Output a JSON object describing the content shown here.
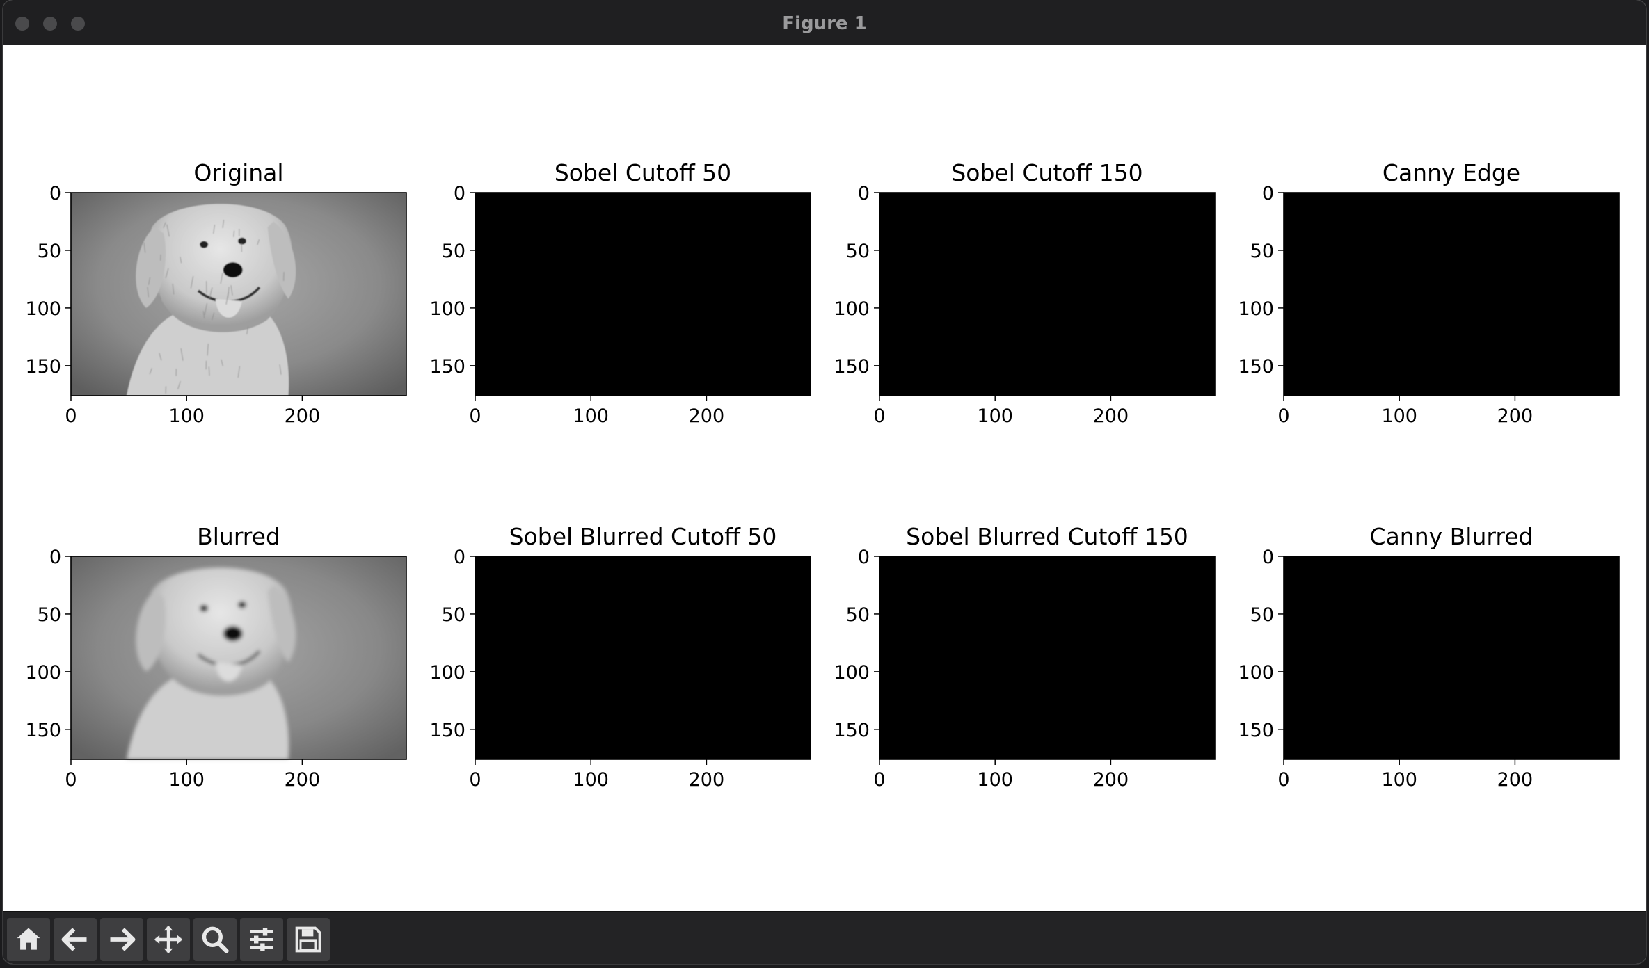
{
  "window": {
    "title": "Figure 1"
  },
  "figure": {
    "panels": [
      {
        "id": "original",
        "title": "Original",
        "kind": "photo",
        "sharp": true
      },
      {
        "id": "sobel50",
        "title": "Sobel Cutoff 50",
        "kind": "sobel",
        "density": 0.9,
        "thick": 1.0
      },
      {
        "id": "sobel150",
        "title": "Sobel Cutoff 150",
        "kind": "sobel",
        "density": 0.45,
        "thick": 0.9
      },
      {
        "id": "canny",
        "title": "Canny Edge",
        "kind": "canny",
        "density": 1.0,
        "thick": 0.5
      },
      {
        "id": "blurred",
        "title": "Blurred",
        "kind": "photo",
        "sharp": false
      },
      {
        "id": "sobelblur50",
        "title": "Sobel Blurred Cutoff 50",
        "kind": "sobel",
        "density": 0.75,
        "thick": 1.4
      },
      {
        "id": "sobelblur150",
        "title": "Sobel Blurred Cutoff 150",
        "kind": "sobel",
        "density": 0.3,
        "thick": 1.2
      },
      {
        "id": "cannyblur",
        "title": "Canny Blurred",
        "kind": "canny",
        "density": 0.55,
        "thick": 0.5
      }
    ],
    "x_ticks": [
      "0",
      "100",
      "200"
    ],
    "y_ticks": [
      "0",
      "50",
      "100",
      "150"
    ]
  },
  "toolbar": {
    "buttons": [
      {
        "name": "home-button",
        "icon": "home-icon"
      },
      {
        "name": "back-button",
        "icon": "arrow-left-icon"
      },
      {
        "name": "forward-button",
        "icon": "arrow-right-icon"
      },
      {
        "name": "pan-button",
        "icon": "move-icon"
      },
      {
        "name": "zoom-button",
        "icon": "magnifier-icon"
      },
      {
        "name": "configure-subplots-button",
        "icon": "sliders-icon"
      },
      {
        "name": "save-button",
        "icon": "floppy-disk-icon"
      }
    ]
  }
}
